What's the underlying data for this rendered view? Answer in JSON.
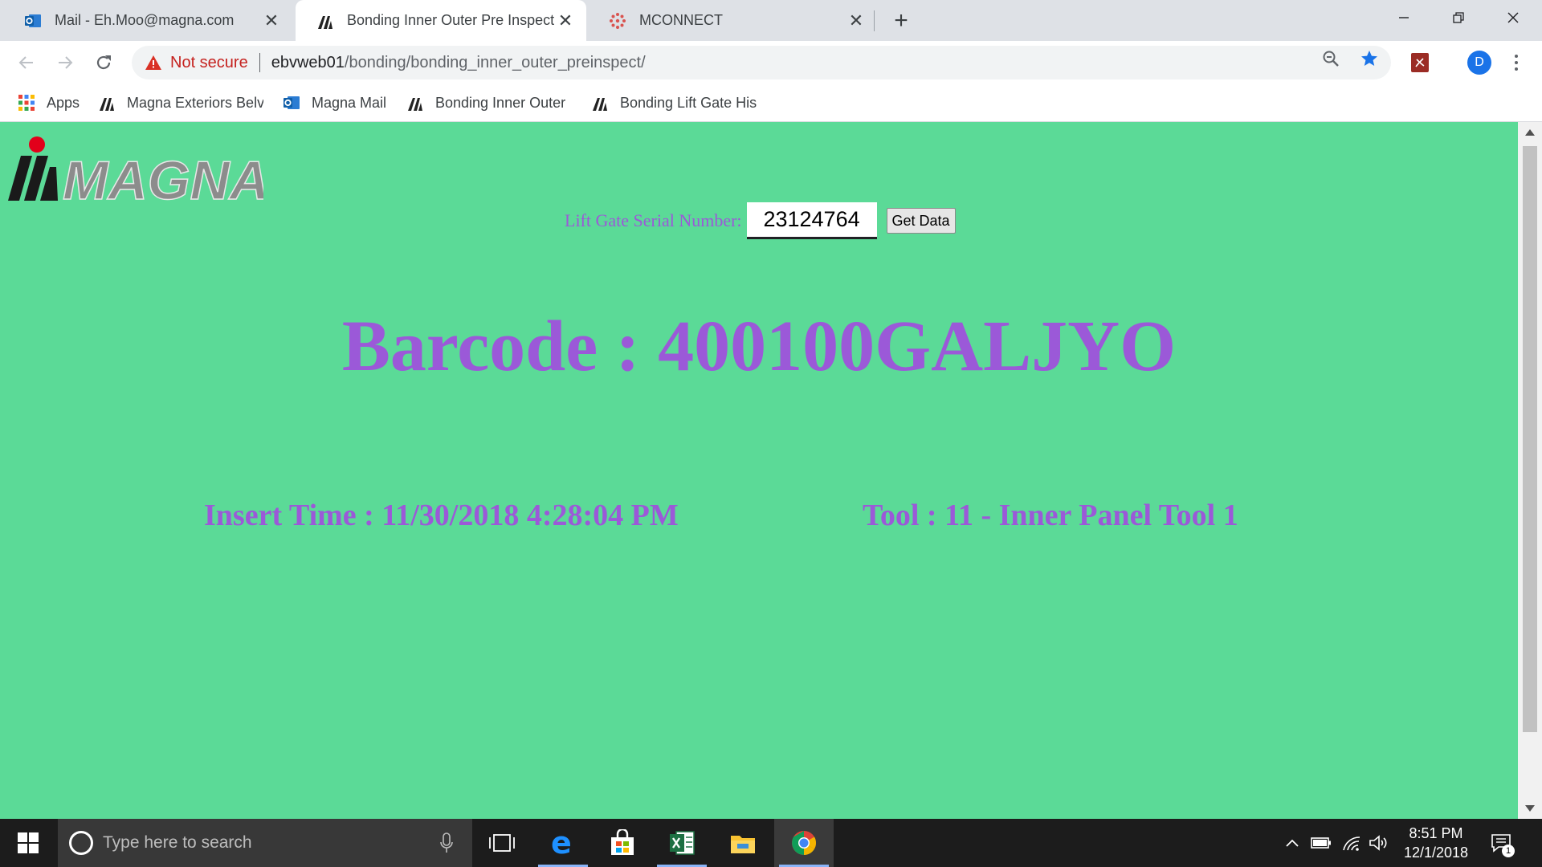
{
  "browser": {
    "tabs": [
      {
        "title": "Mail - Eh.Moo@magna.com",
        "icon": "outlook-icon",
        "active": false
      },
      {
        "title": "Bonding Inner Outer Pre Inspect",
        "icon": "magna-icon",
        "active": true
      },
      {
        "title": "MCONNECT",
        "icon": "mconnect-icon",
        "active": false
      }
    ],
    "address": {
      "security_label": "Not secure",
      "host": "ebvweb01",
      "path": "/bonding/bonding_inner_outer_preinspect/"
    },
    "profile_initial": "D",
    "bookmarks": [
      {
        "label": "Apps",
        "icon": "apps-grid-icon"
      },
      {
        "label": "Magna Exteriors Belvi",
        "icon": "magna-icon"
      },
      {
        "label": "Magna Mail",
        "icon": "outlook-icon"
      },
      {
        "label": "Bonding Inner Outer",
        "icon": "magna-icon"
      },
      {
        "label": "Bonding Lift Gate His",
        "icon": "magna-icon"
      }
    ]
  },
  "page": {
    "logo_text": "MAGNA",
    "form": {
      "label": "Lift Gate Serial Number:",
      "serial_value": "23124764",
      "button_label": "Get Data"
    },
    "barcode_text": "Barcode : 400100GALJYO",
    "insert_time_text": "Insert Time : 11/30/2018 4:28:04 PM",
    "tool_text": "Tool : 11 - Inner Panel Tool 1",
    "colors": {
      "background": "#5bda97",
      "text": "#9b59d8"
    }
  },
  "taskbar": {
    "search_placeholder": "Type here to search",
    "time": "8:51 PM",
    "date": "12/1/2018",
    "notification_count": "1"
  }
}
